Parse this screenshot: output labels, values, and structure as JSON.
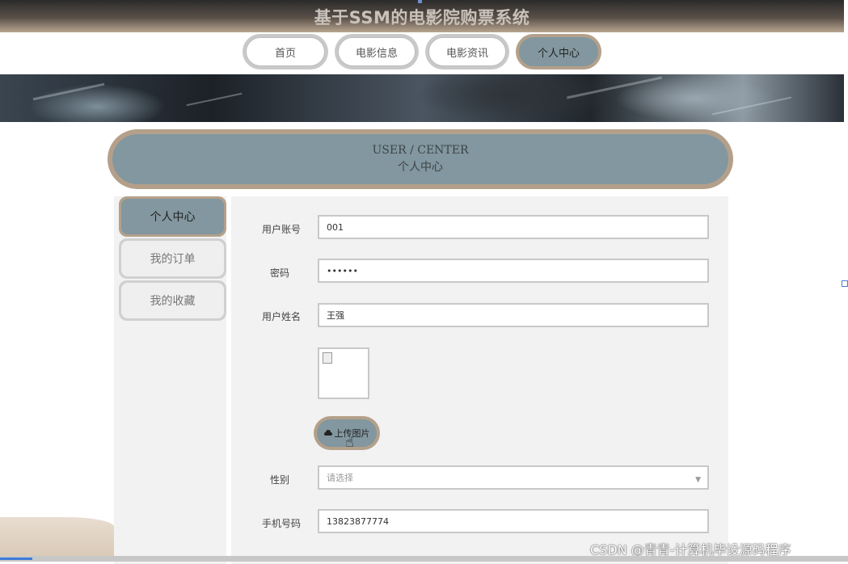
{
  "site": {
    "title": "基于SSM的电影院购票系统"
  },
  "nav": {
    "items": [
      {
        "label": "首页",
        "active": false
      },
      {
        "label": "电影信息",
        "active": false
      },
      {
        "label": "电影资讯",
        "active": false
      },
      {
        "label": "个人中心",
        "active": true
      }
    ]
  },
  "section_header": {
    "en": "USER / CENTER",
    "cn": "个人中心"
  },
  "sidebar": {
    "items": [
      {
        "label": "个人中心",
        "active": true
      },
      {
        "label": "我的订单",
        "active": false
      },
      {
        "label": "我的收藏",
        "active": false
      }
    ]
  },
  "form": {
    "account": {
      "label": "用户账号",
      "value": "001"
    },
    "password": {
      "label": "密码",
      "value": "••••••"
    },
    "name": {
      "label": "用户姓名",
      "value": "王强"
    },
    "upload": {
      "label": "上传图片",
      "icon": "cloud-upload-icon"
    },
    "gender": {
      "label": "性别",
      "placeholder": "请选择"
    },
    "phone": {
      "label": "手机号码",
      "value": "13823877774"
    }
  },
  "watermark": "CSDN @青青-计算机毕设源码程序",
  "colors": {
    "accent": "#82979f",
    "border_accent": "#b4a08a"
  }
}
